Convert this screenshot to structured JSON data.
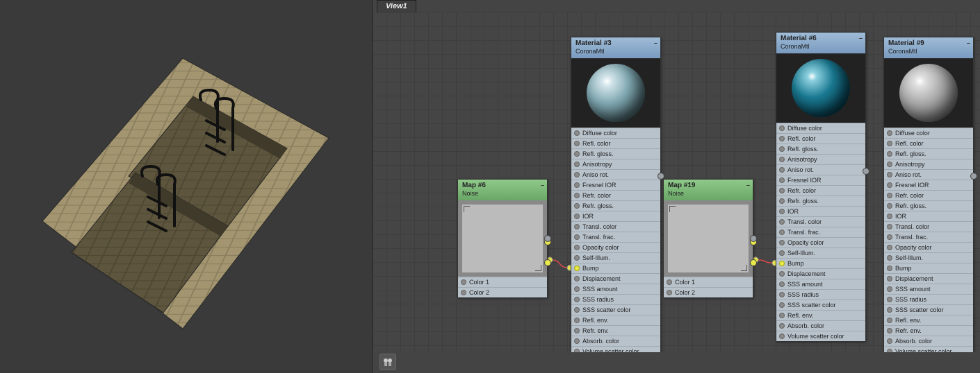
{
  "view": {
    "tab_label": "View1"
  },
  "nodes": {
    "map6": {
      "title": "Map #6",
      "subtype": "Noise",
      "outputs": [
        "Color 1",
        "Color 2"
      ]
    },
    "map19": {
      "title": "Map #19",
      "subtype": "Noise",
      "outputs": [
        "Color 1",
        "Color 2"
      ]
    },
    "mat3": {
      "title": "Material #3",
      "subtype": "CoronaMtl"
    },
    "mat6": {
      "title": "Material #6",
      "subtype": "CoronaMtl"
    },
    "mat9": {
      "title": "Material #9",
      "subtype": "CoronaMtl"
    }
  },
  "material_slots_full": [
    "Diffuse color",
    "Refl. color",
    "Refl. gloss.",
    "Anisotropy",
    "Aniso rot.",
    "Fresnel IOR",
    "Refr. color",
    "Refr. gloss.",
    "IOR",
    "Transl. color",
    "Transl. frac.",
    "Opacity color",
    "Self-Illum.",
    "Bump",
    "Displacement",
    "SSS amount",
    "SSS radius",
    "SSS scatter color",
    "Refl. env.",
    "Refr. env.",
    "Absorb. color",
    "Volume scatter color"
  ],
  "material_slots_mat6": [
    "Diffuse color",
    "Refl. color",
    "Refl. gloss.",
    "Anisotropy",
    "Aniso rot.",
    "Fresnel IOR",
    "Refr. color",
    "Refr. gloss.",
    "IOR",
    "Transl. color",
    "Transl. frac.",
    "Opacity color",
    "Self-Illum.",
    "Bump",
    "Displacement",
    "SSS amount",
    "SSS radius",
    "SSS scatter color",
    "Refl. env.",
    "Absorb. color",
    "Volume scatter color"
  ],
  "icons": {
    "navigator": "navigator-icon",
    "minimize": "–"
  }
}
